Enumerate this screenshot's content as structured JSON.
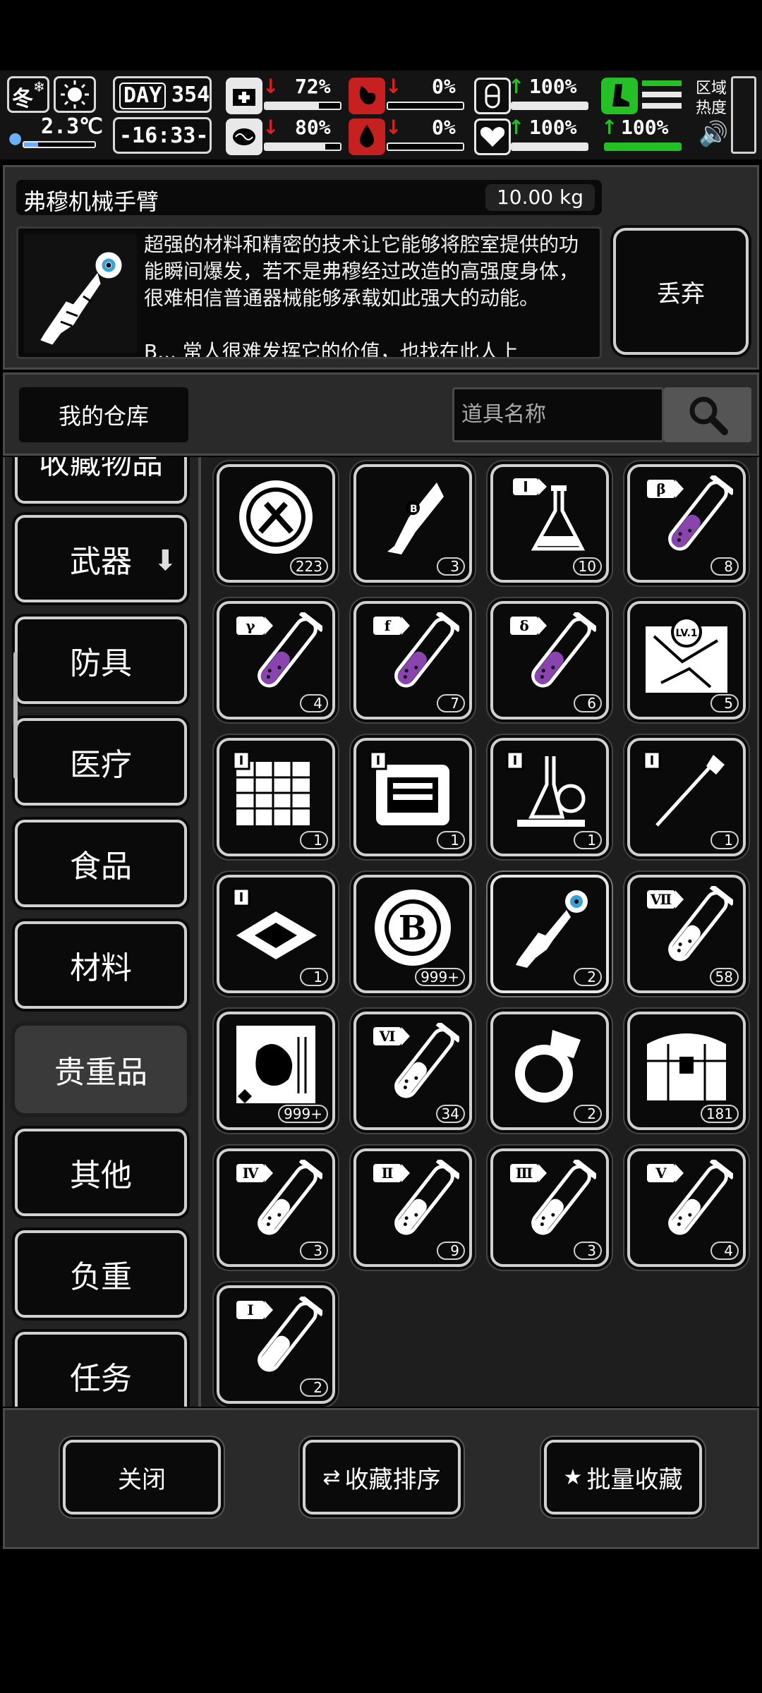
{
  "status": {
    "season": "冬",
    "weather_icon": "sun-icon",
    "temperature": "2.3℃",
    "day_label": "DAY",
    "day_value": "354",
    "time": "-16:33-",
    "stats": [
      {
        "icon": "medkit-icon",
        "trend": "down",
        "value": "72%"
      },
      {
        "icon": "brain-icon",
        "trend": "down",
        "value": "80%"
      },
      {
        "icon": "stomach-icon",
        "trend": "down",
        "value": "0%"
      },
      {
        "icon": "blood-drop-icon",
        "trend": "down",
        "value": "0%"
      },
      {
        "icon": "pill-icon",
        "trend": "up",
        "value": "100%"
      },
      {
        "icon": "heart-icon",
        "trend": "up",
        "value": "100%"
      },
      {
        "icon": "stamina-icon",
        "trend": "up",
        "value": "100%"
      }
    ],
    "area_heat_label": "区域热度",
    "sound_icon": "speaker-icon",
    "colors": {
      "red": "#e02020",
      "green": "#25c025"
    }
  },
  "detail": {
    "title": "弗穆机械手臂",
    "weight": "10.00 kg",
    "description": "超强的材料和精密的技术让它能够将腔室提供的功能瞬间爆发，若不是弗穆经过改造的高强度身体，很难相信普通器械能够承载如此强大的动能。",
    "description_cut": "B... 常人很难发挥它的价值，也找在此人上",
    "discard_label": "丢弃"
  },
  "warehouse": {
    "tab_label": "我的仓库",
    "search_placeholder": "道具名称"
  },
  "categories": [
    {
      "label": "收藏物品"
    },
    {
      "label": "武器",
      "has_arrow": true
    },
    {
      "label": "防具"
    },
    {
      "label": "医疗"
    },
    {
      "label": "食品"
    },
    {
      "label": "材料"
    },
    {
      "label": "贵重品",
      "active": true
    },
    {
      "label": "其他"
    },
    {
      "label": "负重"
    },
    {
      "label": "任务"
    }
  ],
  "items": [
    {
      "icon": "tool-badge-icon",
      "count": "223"
    },
    {
      "icon": "robot-arm-b-icon",
      "count": "3"
    },
    {
      "icon": "flask-i-icon",
      "count": "10"
    },
    {
      "icon": "tube-beta-icon",
      "count": "8"
    },
    {
      "icon": "tube-gamma-icon",
      "count": "4"
    },
    {
      "icon": "tube-f-icon",
      "count": "7"
    },
    {
      "icon": "tube-delta-icon",
      "count": "6"
    },
    {
      "icon": "map-lv1-icon",
      "count": "5"
    },
    {
      "icon": "blueprint-grid-icon",
      "count": "1"
    },
    {
      "icon": "blueprint-machine-icon",
      "count": "1"
    },
    {
      "icon": "blueprint-lab-icon",
      "count": "1"
    },
    {
      "icon": "blueprint-spear-icon",
      "count": "1"
    },
    {
      "icon": "chip-icon",
      "count": "1"
    },
    {
      "icon": "b-coin-icon",
      "count": "999+"
    },
    {
      "icon": "mech-arm-icon",
      "count": "2",
      "selected": true
    },
    {
      "icon": "tube-vii-icon",
      "count": "58"
    },
    {
      "icon": "card-hand-icon",
      "count": "999+"
    },
    {
      "icon": "tube-vi-icon",
      "count": "34"
    },
    {
      "icon": "ring-icon",
      "count": "2"
    },
    {
      "icon": "chest-icon",
      "count": "181"
    },
    {
      "icon": "tube-iv-icon",
      "count": "3"
    },
    {
      "icon": "tube-ii-icon",
      "count": "9"
    },
    {
      "icon": "tube-iii-icon",
      "count": "3"
    },
    {
      "icon": "tube-v-icon",
      "count": "4"
    },
    {
      "icon": "tube-i-icon",
      "count": "2"
    }
  ],
  "footer": {
    "close_label": "关闭",
    "sort_label": "收藏排序",
    "batch_label": "批量收藏"
  }
}
